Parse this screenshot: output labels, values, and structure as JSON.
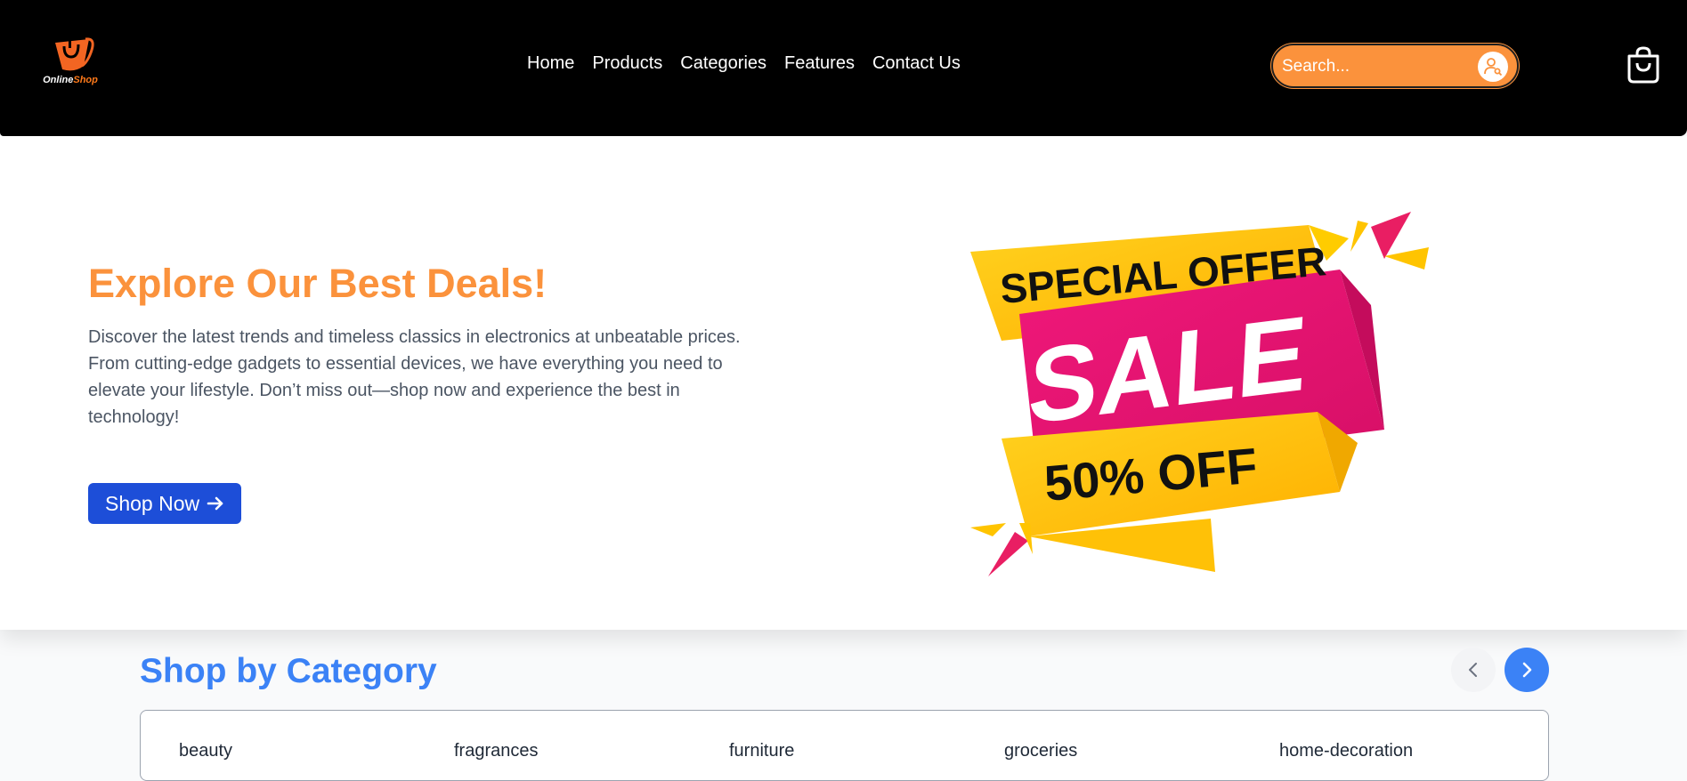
{
  "header": {
    "logo_text_part1": "Online",
    "logo_text_part2": "Shop",
    "nav": [
      "Home",
      "Products",
      "Categories",
      "Features",
      "Contact Us"
    ],
    "search_placeholder": "Search...",
    "brand_color": "#fb923c",
    "icons": {
      "search_user": "user-search-icon",
      "cart": "shopping-bag-icon"
    }
  },
  "hero": {
    "title": "Explore Our Best Deals!",
    "description": "Discover the latest trends and timeless classics in electronics at unbeatable prices. From cutting-edge gadgets to essential devices, we have everything you need to elevate your lifestyle. Don’t miss out—shop now and experience the best in technology!",
    "button_label": "Shop Now",
    "button_icon": "arrow-right-icon",
    "button_color": "#1d4ed8",
    "sale_banner": {
      "line1": "SPECIAL OFFER",
      "line2": "SALE",
      "line3": "50% OFF"
    }
  },
  "categories": {
    "title": "Shop by Category",
    "title_color": "#3b82f6",
    "items": [
      "beauty",
      "fragrances",
      "furniture",
      "groceries",
      "home-decoration"
    ],
    "prev_icon": "chevron-left-icon",
    "next_icon": "chevron-right-icon"
  }
}
